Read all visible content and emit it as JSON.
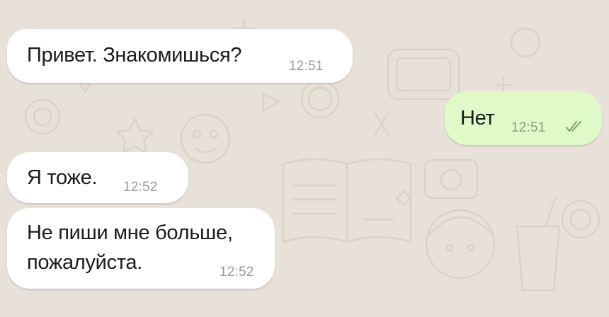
{
  "colors": {
    "background": "#e7e1d9",
    "incoming_bubble": "#ffffff",
    "outgoing_bubble": "#e0f9c9",
    "text": "#1b1b1b",
    "time": "#9a9a9a",
    "read_check": "#7fa36b"
  },
  "messages": [
    {
      "direction": "incoming",
      "text": "Привет. Знакомишься?",
      "time": "12:51"
    },
    {
      "direction": "outgoing",
      "text": "Нет",
      "time": "12:51",
      "status_icon": "double-check-icon"
    },
    {
      "direction": "incoming",
      "text": "Я тоже.",
      "time": "12:52"
    },
    {
      "direction": "incoming",
      "text": "Не пиши мне больше,\nпожалуйста.",
      "time": "12:52"
    }
  ]
}
